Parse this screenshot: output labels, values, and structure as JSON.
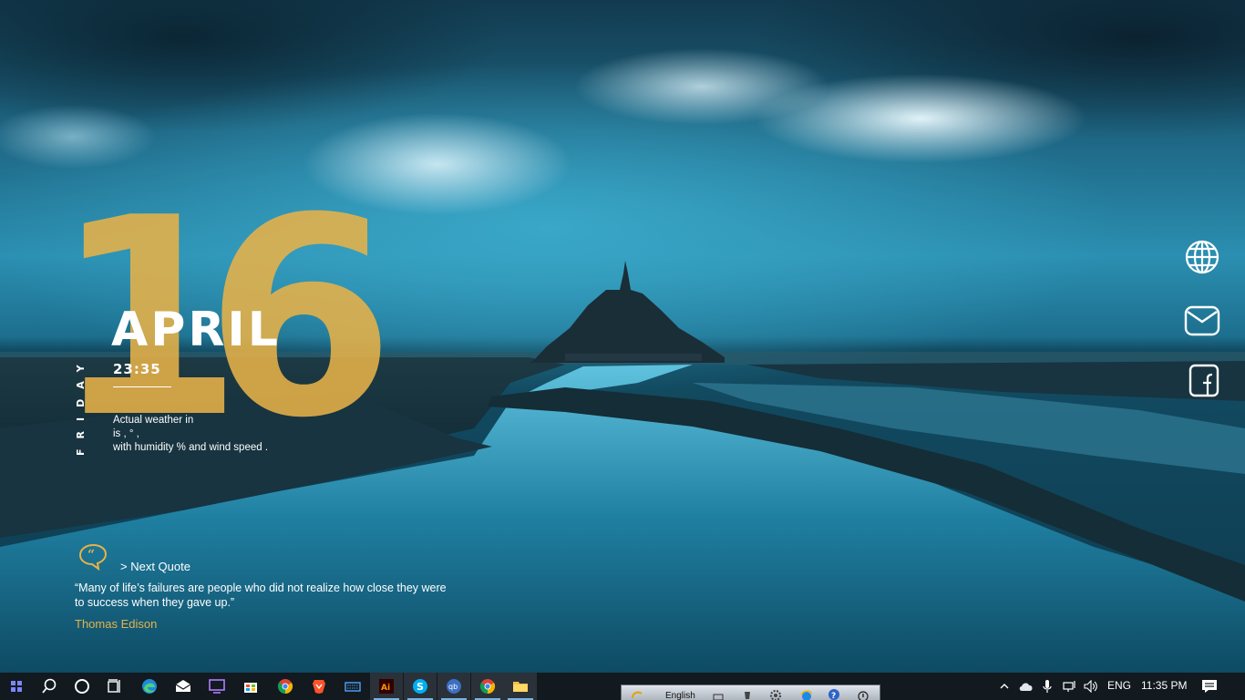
{
  "widget": {
    "day_number": "16",
    "month": "APRIL",
    "weekday": "FRIDAY",
    "time": "23:35",
    "weather_line1": "Actual weather in",
    "weather_line2": "is , ° ,",
    "weather_line3": "with humidity  % and wind speed    ."
  },
  "quote": {
    "next_label": "> Next Quote",
    "text": "“Many of life’s failures are people who did not realize how close they were to success when they gave up.”",
    "author": "Thomas Edison"
  },
  "side_links": [
    {
      "icon": "globe-icon"
    },
    {
      "icon": "mail-icon"
    },
    {
      "icon": "facebook-icon"
    }
  ],
  "taskbar": {
    "apps": [
      "start",
      "search",
      "cortana",
      "task-view",
      "edge",
      "mail",
      "remote-desktop",
      "store",
      "chrome",
      "brave",
      "keyboard",
      "illustrator",
      "skype",
      "qbittorrent",
      "chrome",
      "file-explorer"
    ],
    "language_bar_label": "English",
    "input_language": "ENG",
    "clock": "11:35 PM"
  },
  "colors": {
    "accent": "#e7b248",
    "taskbar": "#12191f"
  }
}
